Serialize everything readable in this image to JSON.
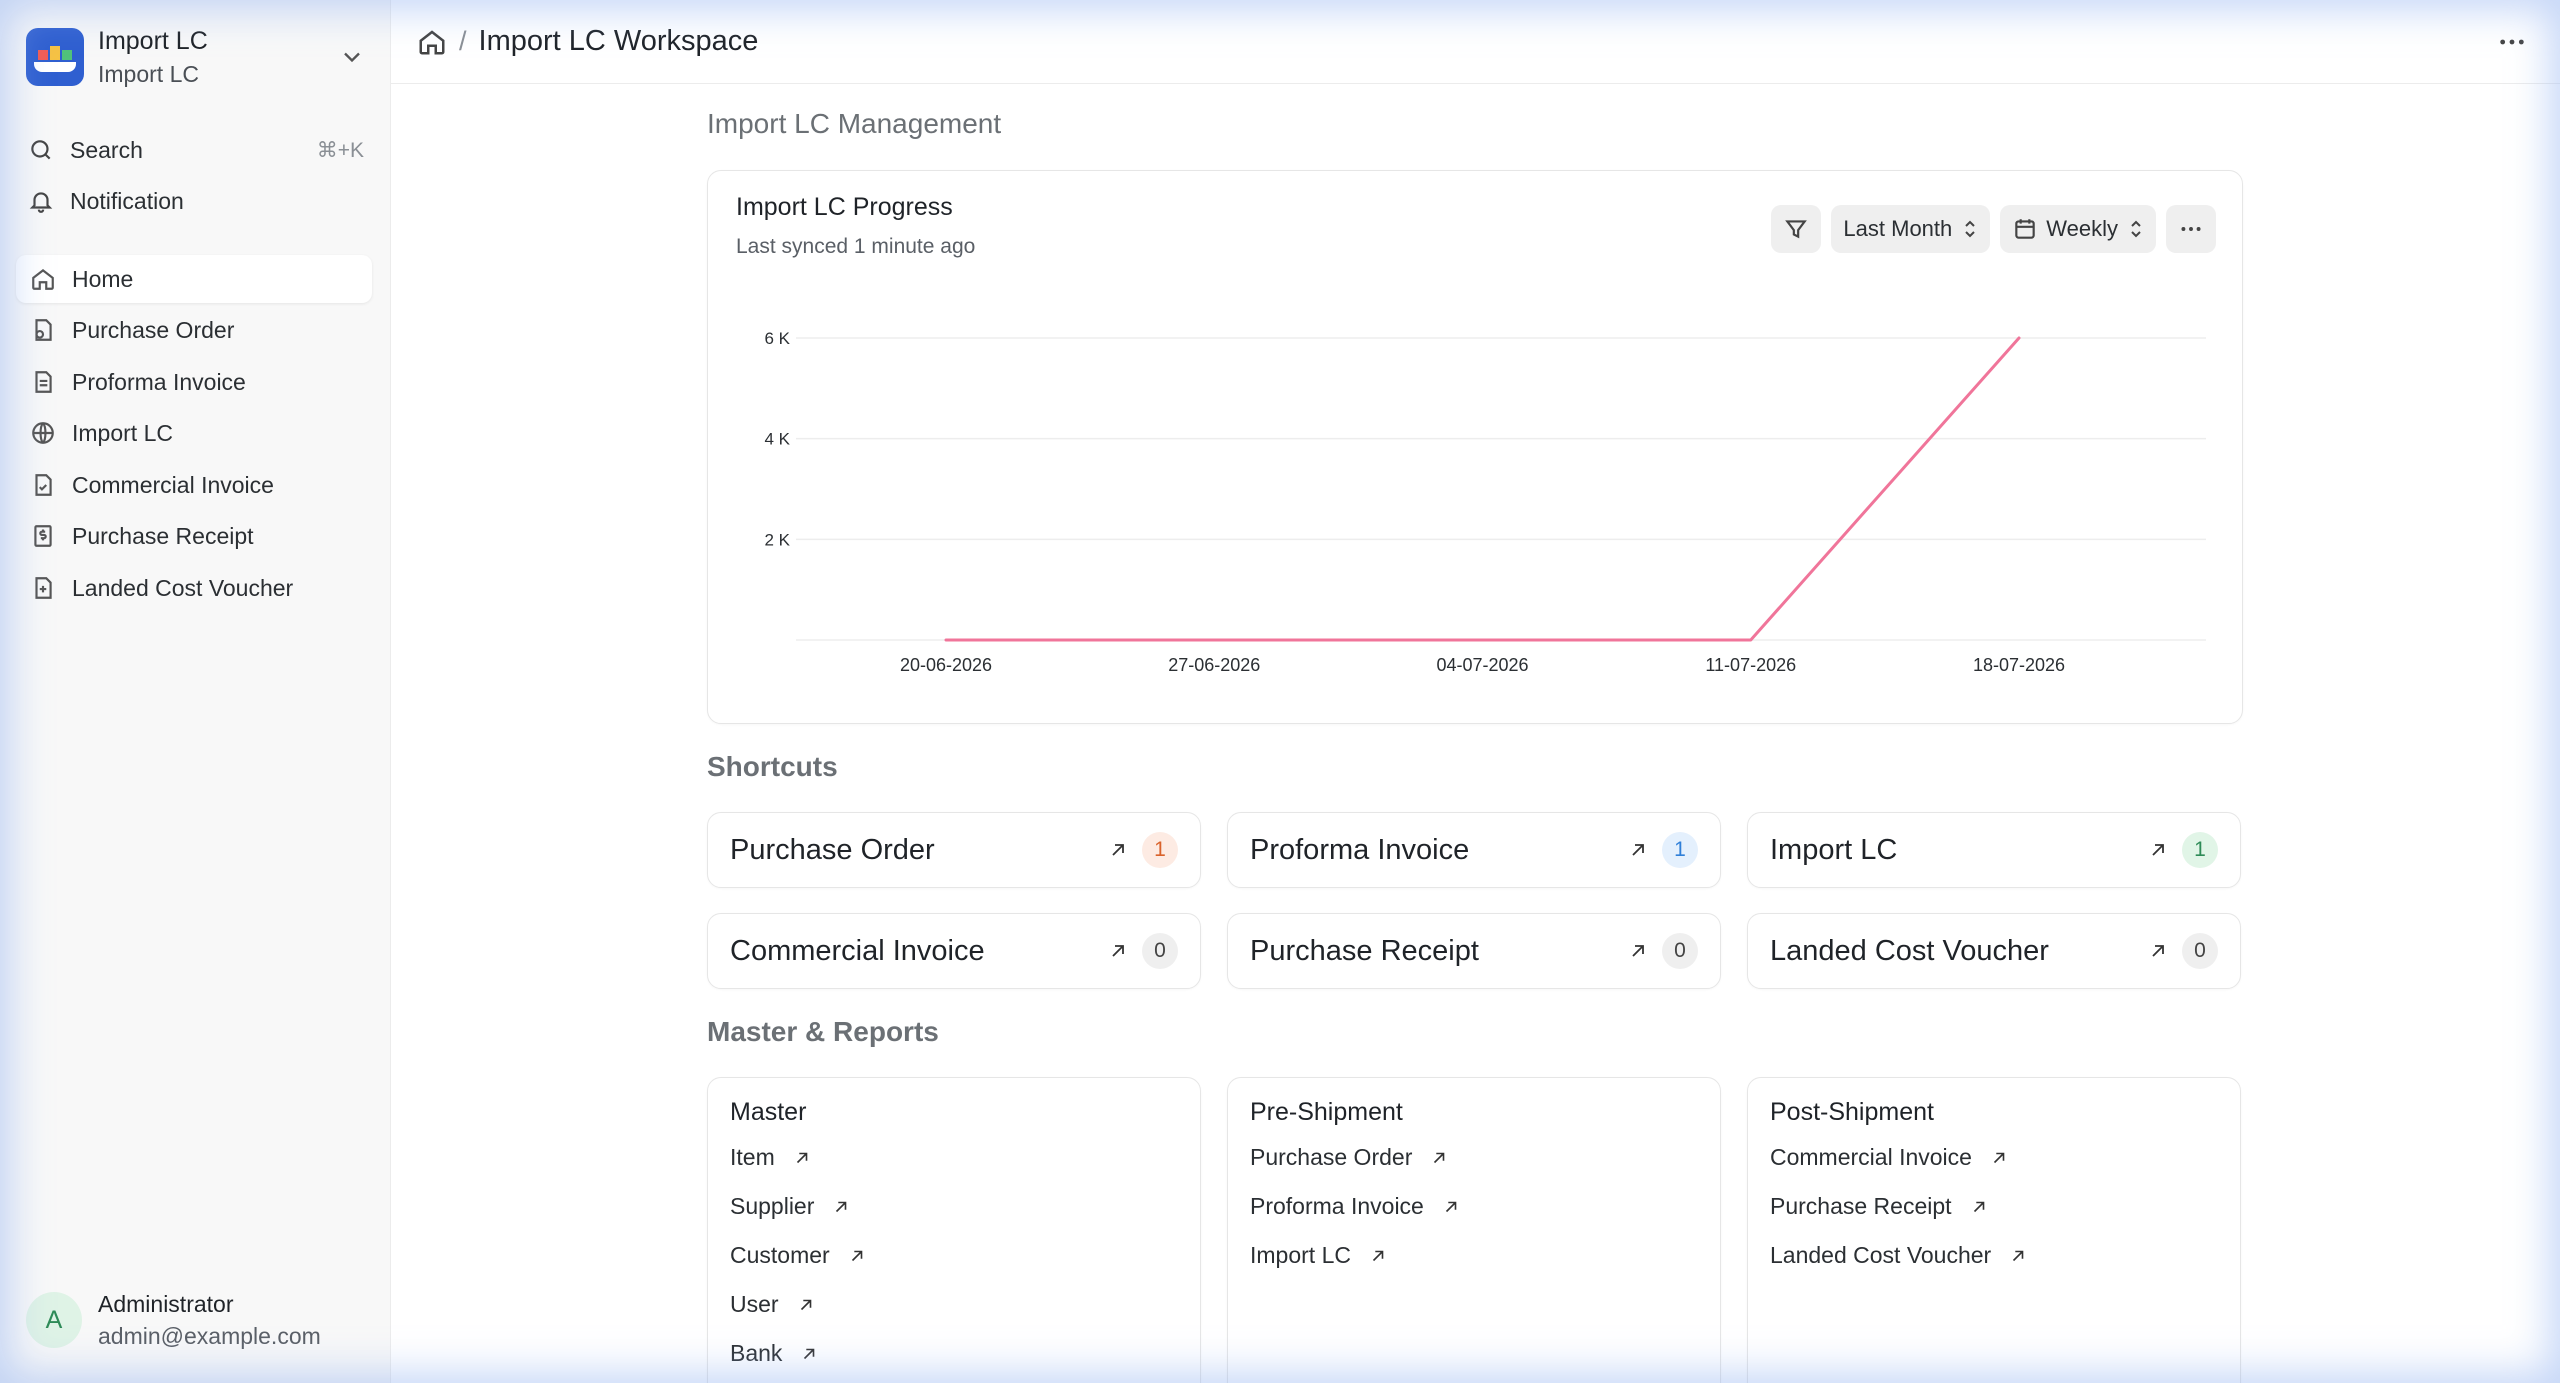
{
  "workspace": {
    "title": "Import LC",
    "subtitle": "Import LC"
  },
  "sidebar": {
    "search_label": "Search",
    "search_shortcut": "⌘+K",
    "notification_label": "Notification",
    "items": [
      {
        "label": "Home",
        "icon": "home-icon"
      },
      {
        "label": "Purchase Order",
        "icon": "purchase-order-icon"
      },
      {
        "label": "Proforma Invoice",
        "icon": "document-icon"
      },
      {
        "label": "Import LC",
        "icon": "globe-icon"
      },
      {
        "label": "Commercial Invoice",
        "icon": "invoice-icon"
      },
      {
        "label": "Purchase Receipt",
        "icon": "dollar-receipt-icon"
      },
      {
        "label": "Landed Cost Voucher",
        "icon": "file-plus-icon"
      }
    ],
    "user": {
      "initial": "A",
      "name": "Administrator",
      "email": "admin@example.com"
    }
  },
  "topbar": {
    "breadcrumb_sep": "/",
    "title": "Import LC Workspace"
  },
  "main": {
    "section_title": "Import LC Management",
    "chart_card": {
      "title": "Import LC Progress",
      "subtitle": "Last synced 1 minute ago",
      "range_label": "Last Month",
      "interval_label": "Weekly"
    },
    "shortcuts_title": "Shortcuts",
    "shortcuts": [
      {
        "label": "Purchase Order",
        "count": "1"
      },
      {
        "label": "Proforma Invoice",
        "count": "1"
      },
      {
        "label": "Import LC",
        "count": "1"
      },
      {
        "label": "Commercial Invoice",
        "count": "0"
      },
      {
        "label": "Purchase Receipt",
        "count": "0"
      },
      {
        "label": "Landed Cost Voucher",
        "count": "0"
      }
    ],
    "reports_title": "Master & Reports",
    "reports": [
      {
        "title": "Master",
        "links": [
          "Item",
          "Supplier",
          "Customer",
          "User",
          "Bank"
        ]
      },
      {
        "title": "Pre-Shipment",
        "links": [
          "Purchase Order",
          "Proforma Invoice",
          "Import LC"
        ]
      },
      {
        "title": "Post-Shipment",
        "links": [
          "Commercial Invoice",
          "Purchase Receipt",
          "Landed Cost Voucher"
        ]
      }
    ]
  },
  "colors": {
    "line": "#f0759a",
    "badge_orange_bg": "#fdebe3",
    "badge_orange_fg": "#d9622b",
    "badge_blue_bg": "#e4f0fd",
    "badge_blue_fg": "#2f7fd8",
    "badge_green_bg": "#e1f5e7",
    "badge_green_fg": "#2e8b57",
    "badge_gray_bg": "#efefef",
    "badge_gray_fg": "#444444"
  },
  "chart_data": {
    "type": "line",
    "x": [
      "20-06-2026",
      "27-06-2026",
      "04-07-2026",
      "11-07-2026",
      "18-07-2026"
    ],
    "series": [
      {
        "values": [
          0,
          0,
          0,
          0,
          6000
        ]
      }
    ],
    "ylim": [
      0,
      6000
    ],
    "yticks": [
      2000,
      4000,
      6000
    ],
    "ytick_labels": [
      "2 K",
      "4 K",
      "6 K"
    ],
    "grid": true,
    "legend": "none"
  }
}
